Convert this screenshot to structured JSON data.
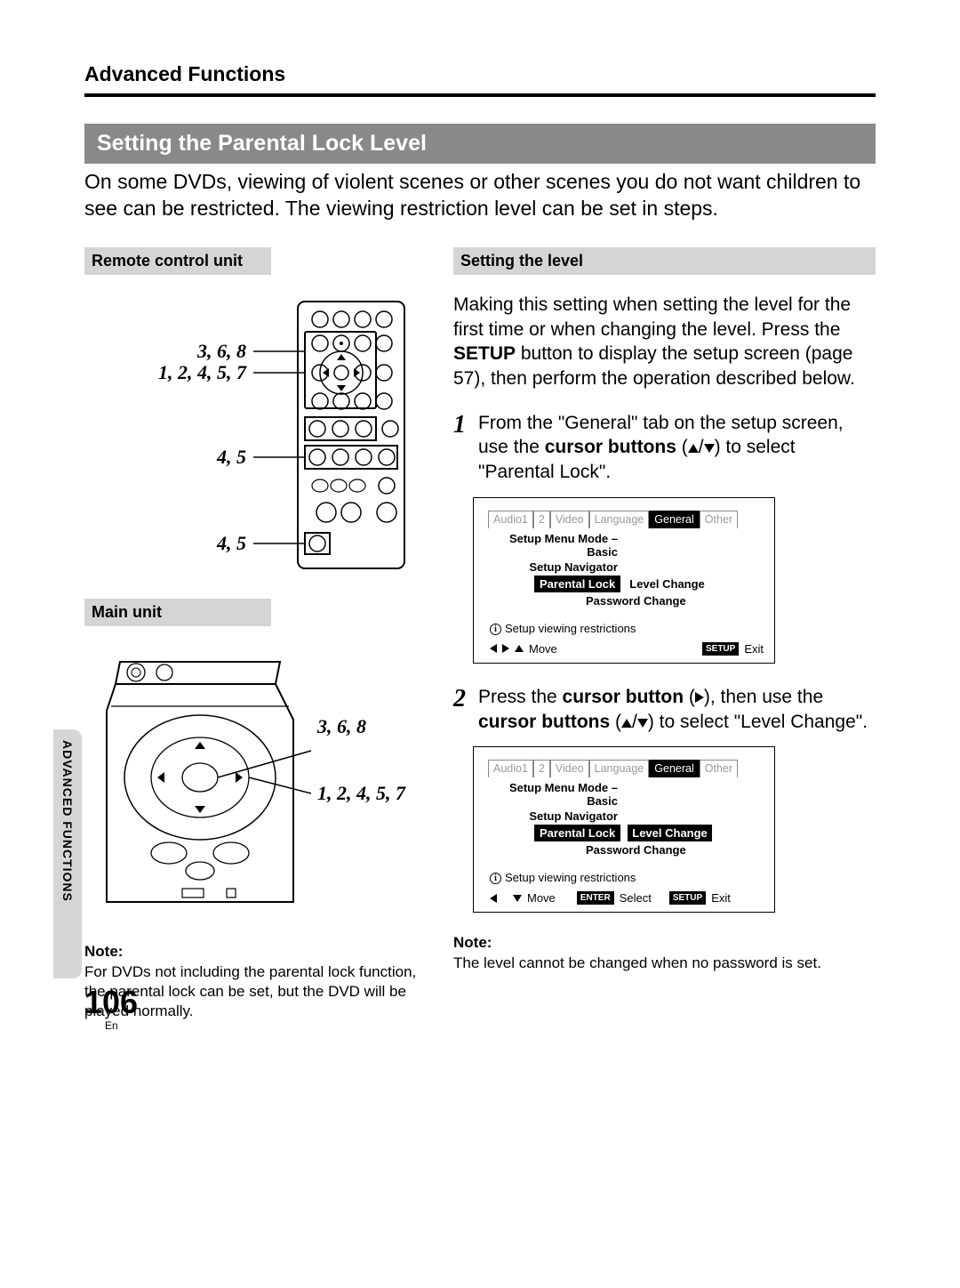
{
  "header": {
    "section": "Advanced Functions"
  },
  "title_bar": "Setting the Parental Lock Level",
  "intro": "On some DVDs, viewing of violent scenes or other scenes you do not want children to see can be restricted.  The viewing restriction level can be set in steps.",
  "left": {
    "remote_header": "Remote control unit",
    "main_header": "Main unit",
    "remote_labels": {
      "a": "3, 6, 8",
      "b": "1, 2, 4, 5, 7",
      "c": "4, 5",
      "d": "4, 5"
    },
    "main_labels": {
      "a": "3, 6, 8",
      "b": "1, 2, 4, 5, 7"
    },
    "note_heading": "Note:",
    "note_text": "For DVDs not including the parental lock function, the parental lock can be set, but the DVD will be played normally."
  },
  "right": {
    "sub_header": "Setting the level",
    "intro_a": "Making this setting when setting the level for the first time or when changing the level.  Press the ",
    "intro_b_bold": "SETUP",
    "intro_c": " button to display the setup screen (page 57), then perform the operation described below.",
    "step1": {
      "num": "1",
      "a": "From the \"General\" tab on the setup screen, use the ",
      "b_bold": "cursor buttons",
      "c": " (",
      "d": "/",
      "e": ") to select \"Parental Lock\"."
    },
    "step2": {
      "num": "2",
      "a": "Press the ",
      "b_bold": "cursor button",
      "c": " (",
      "d": "), then use the ",
      "e_bold": "cursor buttons",
      "f": " (",
      "g": "/",
      "h": ") to select \"Level Change\"."
    },
    "osd": {
      "tabs": [
        "Audio1",
        "2",
        "Video",
        "Language",
        "General",
        "Other"
      ],
      "active_tab_index": 4,
      "row1": "Setup Menu Mode – Basic",
      "row2": "Setup Navigator",
      "row3_label": "Parental Lock",
      "row3_val": "Level Change",
      "row4_val": "Password Change",
      "info": "Setup viewing restrictions",
      "move": "Move",
      "select": "Select",
      "enter_btn": "ENTER",
      "setup_btn": "SETUP",
      "exit": "Exit"
    },
    "note_heading": "Note:",
    "note_text": "The level cannot be changed when no password is set."
  },
  "side_tab": "ADVANCED FUNCTIONS",
  "page_number": "106",
  "page_lang": "En"
}
